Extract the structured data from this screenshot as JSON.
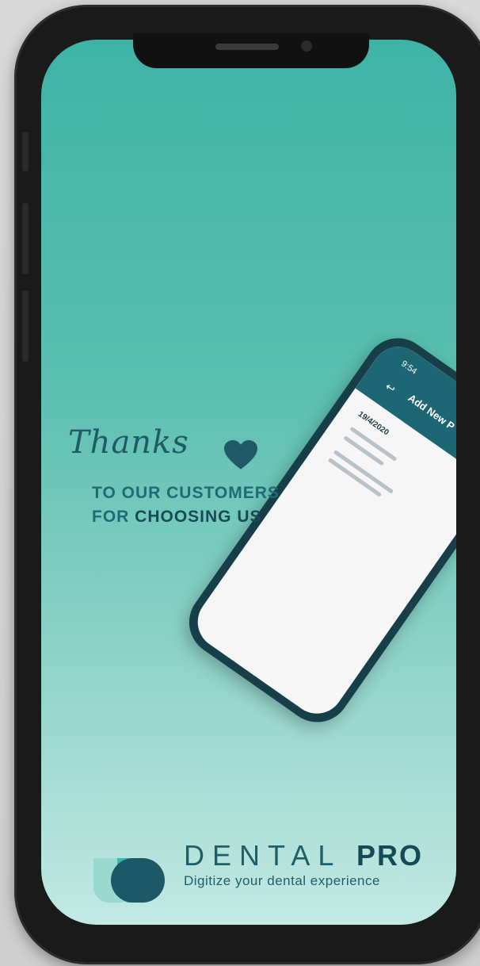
{
  "splash": {
    "thanks_script": "Thanks",
    "line1": "TO OUR CUSTOMERS",
    "line2_prefix": "FOR ",
    "line2_accent": "CHOOSING US"
  },
  "mockup_phone": {
    "time": "9:54",
    "back_icon": "back-arrow-icon",
    "title": "Add New P",
    "date": "19/4/2020"
  },
  "brand": {
    "name_part1": "DENTAL ",
    "name_part2": "PRO",
    "tagline": "Digitize your dental experience"
  },
  "colors": {
    "screen_top": "#3eb3a6",
    "screen_bottom": "#c3e9e3",
    "brand_text": "#1f5f6a",
    "heart": "#1f5a66"
  },
  "icons": [
    "heart-icon",
    "dental-pro-logo-icon",
    "back-arrow-icon"
  ]
}
